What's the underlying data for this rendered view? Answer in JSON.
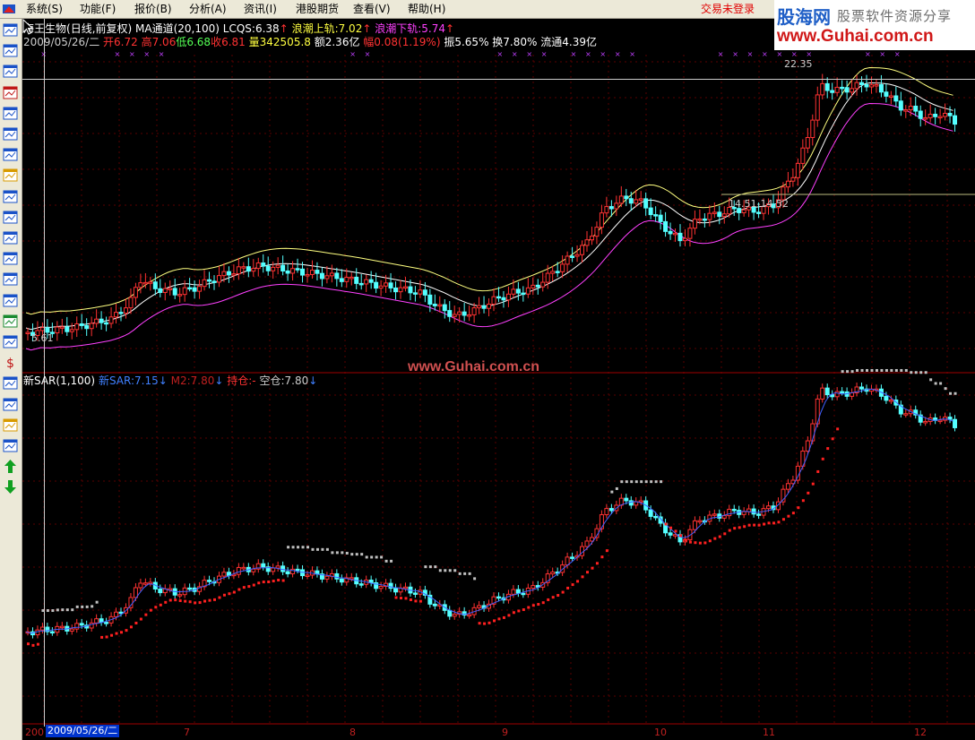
{
  "menu": {
    "items": [
      "系统(S)",
      "功能(F)",
      "报价(B)",
      "分析(A)",
      "资讯(I)",
      "港股期货",
      "查看(V)",
      "帮助(H)"
    ],
    "login_status": "交易未登录"
  },
  "brand": {
    "logo": "股海网",
    "slogan": "股票软件资源分享",
    "url": "www.Guhai.com.cn"
  },
  "toolbar": {
    "icons": [
      "chart-icon",
      "list-icon",
      "line-chart-icon",
      "candle-icon",
      "window-icon",
      "table-icon",
      "report-icon",
      "mail-icon",
      "users-icon",
      "f10-icon",
      "zoom-icon",
      "etf-icon",
      "indicator-icon",
      "rsi-icon",
      "refresh-icon",
      "calc-icon",
      "money-icon",
      "pen-icon",
      "export-icon",
      "draw-icon",
      "move-icon",
      "up-arrow-icon",
      "down-arrow-icon"
    ]
  },
  "main_chart": {
    "stock_name": "海王生物",
    "period": "(日线,前复权)",
    "indicator": "MA通道(20,100)",
    "lcqs": "LCQS:6.38",
    "upper_band": "浪潮上轨:7.02",
    "lower_band": "浪潮下轨:5.74",
    "date": "2009/05/26/二",
    "open": "开6.72",
    "high": "高7.06",
    "low": "低6.68",
    "close": "收6.81",
    "volume": "量342505.8",
    "amount": "额2.36亿",
    "change": "幅0.08(1.19%)",
    "amplitude": "振5.65%",
    "turnover": "换7.80%",
    "float": "流通4.39亿",
    "annot_high": "22.35",
    "annot_range": "14.51-14.52",
    "annot_low": "5.61"
  },
  "sub_chart": {
    "indicator": "新SAR(1,100)",
    "sar": "新SAR:7.15",
    "m2": "M2:7.80",
    "hold": "持仓:-",
    "empty": "空仓:7.80"
  },
  "axis": {
    "months": [
      "7",
      "8",
      "9",
      "10",
      "11",
      "12"
    ],
    "year_prefix": "200",
    "cursor_date": "2009/05/26/二"
  },
  "watermark": "www.Guhai.com.cn",
  "colors": {
    "up": "#ff3232",
    "down": "#54ffff",
    "ma_upper": "#ffff80",
    "ma_mid": "#ffffff",
    "ma_lower": "#ff40ff",
    "sar_blue": "#4060ff",
    "sar_dot_red": "#ff2020",
    "sar_dot_gray": "#c0c0c0"
  }
}
